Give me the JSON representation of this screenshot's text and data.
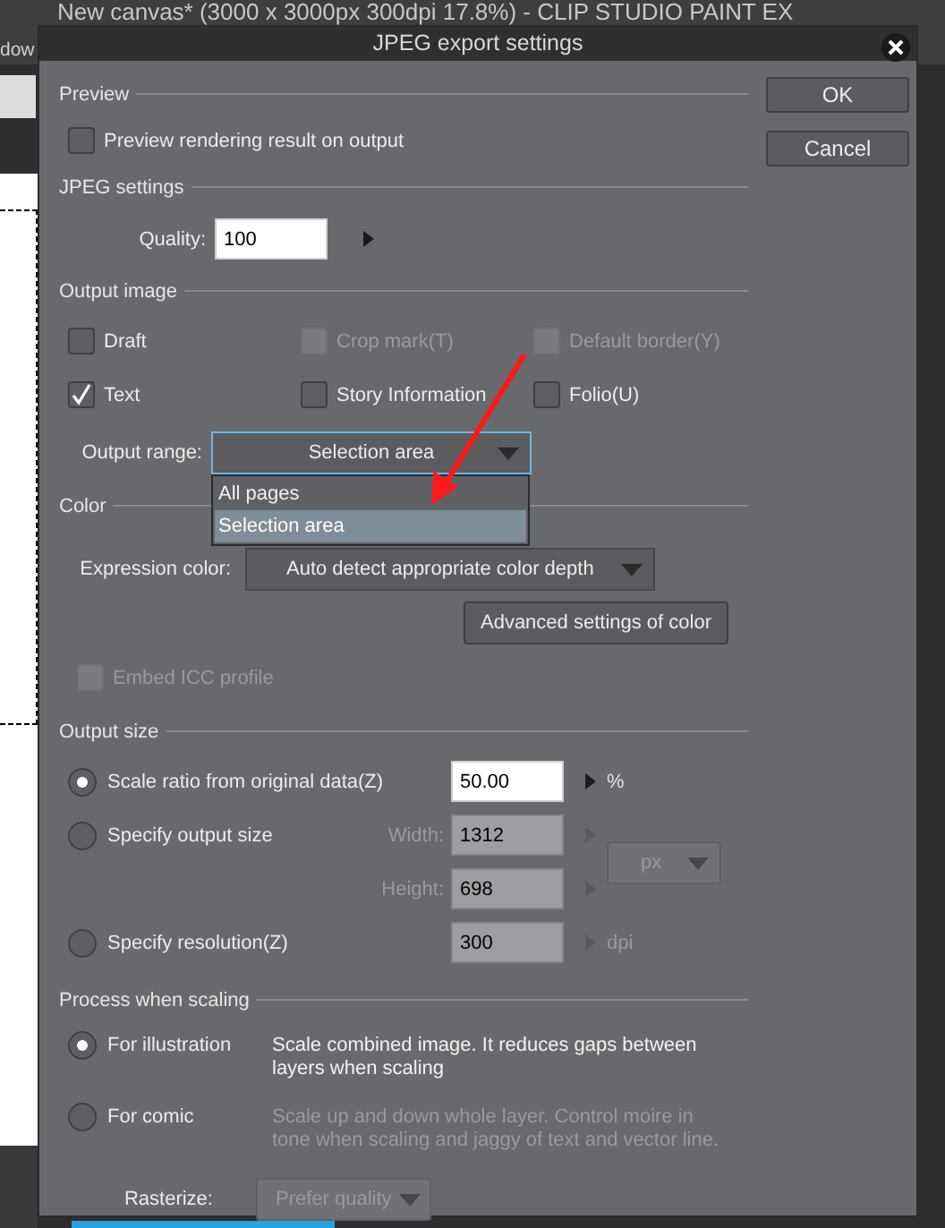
{
  "app_window": {
    "title": "New canvas* (3000 x 3000px 300dpi 17.8%)  - CLIP STUDIO PAINT EX",
    "menu_fragment": "dow"
  },
  "dialog": {
    "title": "JPEG export settings",
    "buttons": [
      "OK",
      "Cancel"
    ]
  },
  "preview": {
    "heading": "Preview",
    "options": [
      {
        "label": "Preview rendering result on output",
        "checked": false,
        "disabled": false
      }
    ]
  },
  "jpeg_settings": {
    "heading": "JPEG settings",
    "quality_label": "Quality:",
    "quality": "100"
  },
  "output_image": {
    "heading": "Output image",
    "options": [
      {
        "label": "Draft",
        "checked": false,
        "disabled": false
      },
      {
        "label": "Crop mark(T)",
        "checked": false,
        "disabled": true
      },
      {
        "label": "Default border(Y)",
        "checked": false,
        "disabled": true
      },
      {
        "label": "Text",
        "checked": true,
        "disabled": false
      },
      {
        "label": "Story Information",
        "checked": false,
        "disabled": false
      },
      {
        "label": "Folio(U)",
        "checked": false,
        "disabled": false
      }
    ],
    "output_range": {
      "label": "Output range:",
      "value": "Selection area",
      "expanded": true,
      "options": [
        {
          "label": "All pages",
          "selected": false
        },
        {
          "label": "Selection area",
          "selected": true
        }
      ]
    }
  },
  "color": {
    "heading": "Color",
    "expression_label": "Expression color:",
    "expression_value": "Auto detect appropriate color depth",
    "advanced_button": "Advanced settings of color",
    "embed_icc": {
      "label": "Embed ICC profile",
      "checked": false,
      "disabled": true
    }
  },
  "output_size": {
    "heading": "Output size",
    "modes": [
      {
        "label": "Scale ratio from original data(Z)",
        "selected": true
      },
      {
        "label": "Specify output size",
        "selected": false
      },
      {
        "label": "Specify resolution(Z)",
        "selected": false
      }
    ],
    "scale": {
      "value": "50.00",
      "unit": "%",
      "disabled": false
    },
    "width": {
      "label": "Width:",
      "value": "1312",
      "disabled": true
    },
    "height": {
      "label": "Height:",
      "value": "698",
      "disabled": true
    },
    "size_unit": {
      "value": "px",
      "disabled": true
    },
    "resolution": {
      "value": "300",
      "unit": "dpi",
      "disabled": true
    }
  },
  "process_when_scaling": {
    "heading": "Process when scaling",
    "options": [
      {
        "label": "For illustration",
        "selected": true,
        "description": "Scale combined image. It reduces gaps between layers when scaling"
      },
      {
        "label": "For comic",
        "selected": false,
        "description": "Scale up and down whole layer. Control moire in tone when scaling and jaggy of text and vector line."
      }
    ],
    "rasterize": {
      "label": "Rasterize:",
      "value": "Prefer quality",
      "disabled": true
    }
  }
}
